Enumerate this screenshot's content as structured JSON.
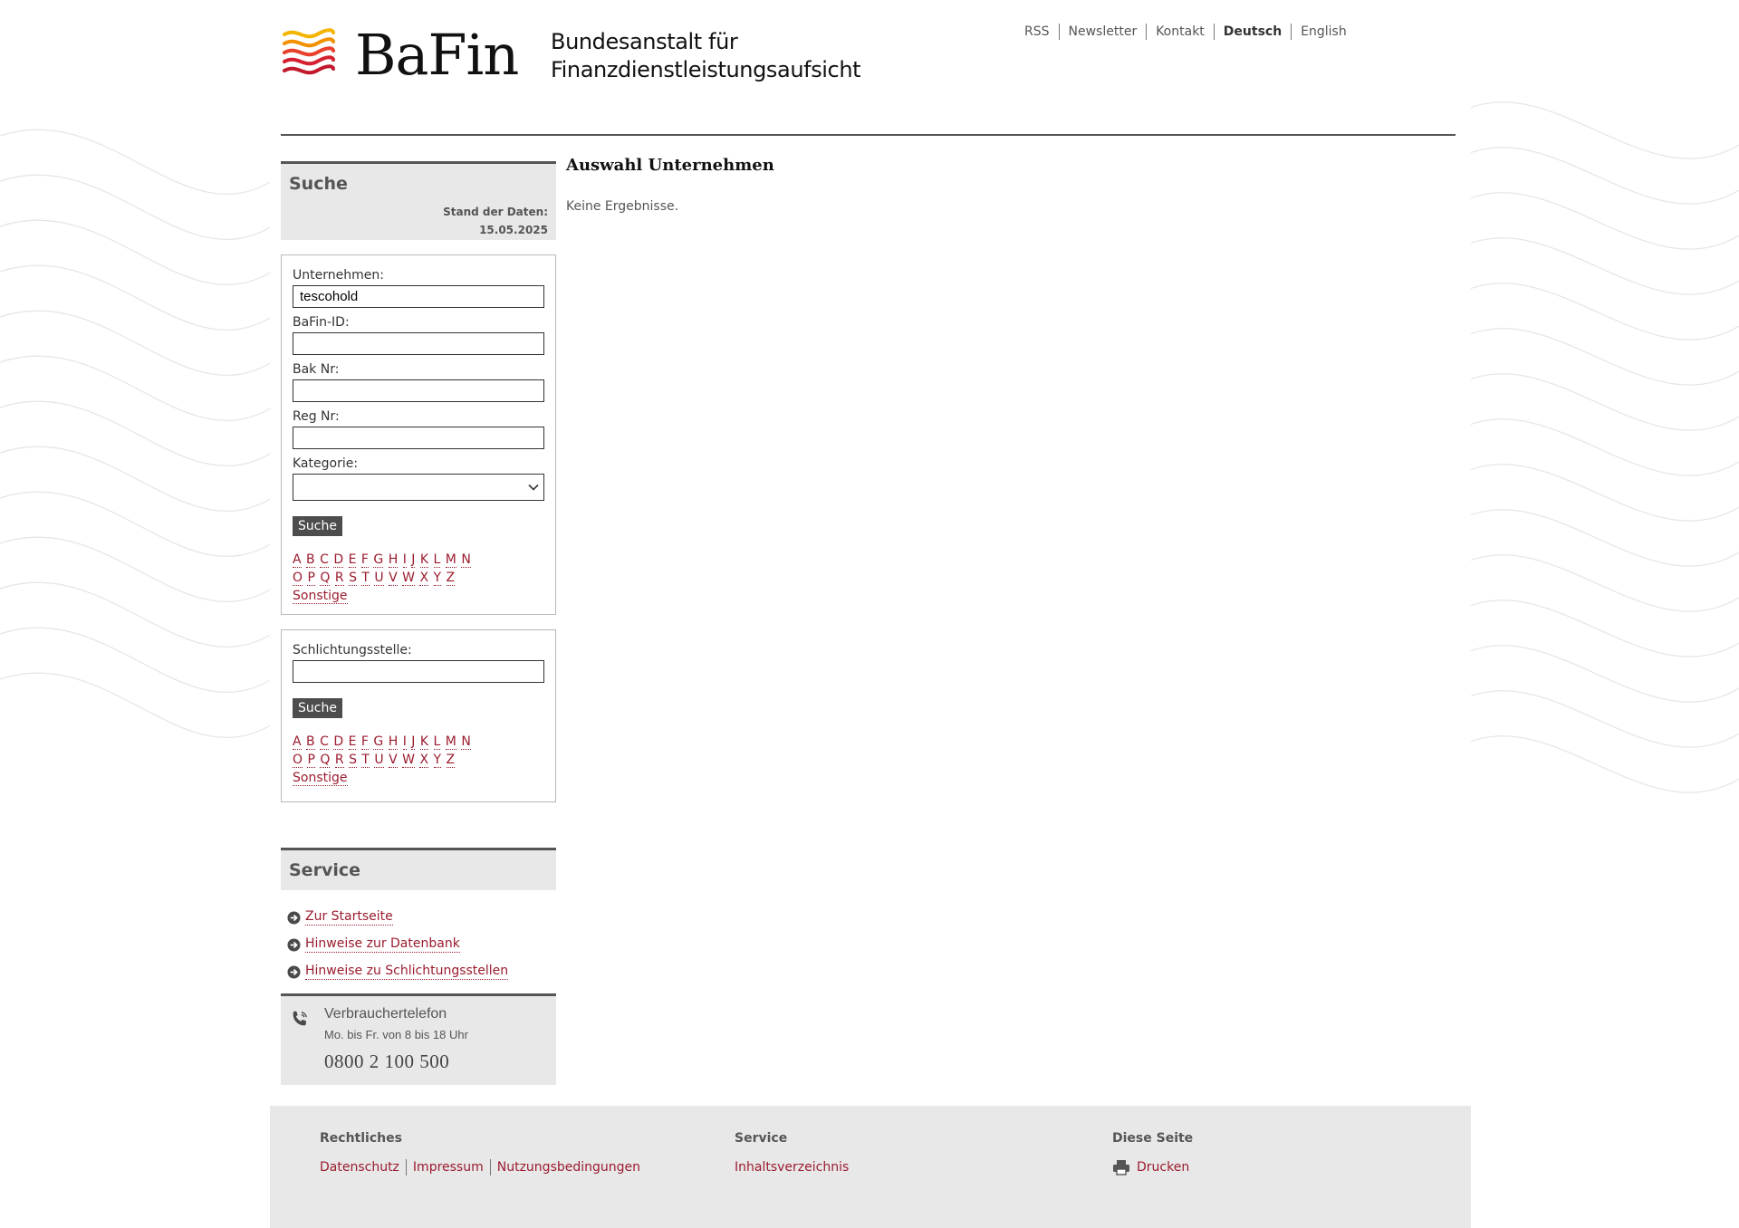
{
  "header": {
    "logo_word": "BaFin",
    "logo_sub_line1": "Bundesanstalt für",
    "logo_sub_line2": "Finanzdienstleistungsaufsicht",
    "nav": [
      {
        "label": "RSS"
      },
      {
        "label": "Newsletter"
      },
      {
        "label": "Kontakt"
      },
      {
        "label": "Deutsch",
        "active": true
      },
      {
        "label": "English"
      }
    ]
  },
  "search": {
    "title": "Suche",
    "stand_label": "Stand der Daten:",
    "stand_date": "15.05.2025",
    "unternehmen_label": "Unternehmen:",
    "unternehmen_value": "tescohold",
    "bafin_id_label": "BaFin-ID:",
    "bafin_id_value": "",
    "bak_nr_label": "Bak Nr:",
    "bak_nr_value": "",
    "reg_nr_label": "Reg Nr:",
    "reg_nr_value": "",
    "kategorie_label": "Kategorie:",
    "kategorie_value": "",
    "button": "Suche",
    "alpha_row1": [
      "A",
      "B",
      "C",
      "D",
      "E",
      "F",
      "G",
      "H",
      "I",
      "J",
      "K",
      "L",
      "M",
      "N"
    ],
    "alpha_row2": [
      "O",
      "P",
      "Q",
      "R",
      "S",
      "T",
      "U",
      "V",
      "W",
      "X",
      "Y",
      "Z"
    ],
    "other": "Sonstige"
  },
  "schlichtung": {
    "label": "Schlichtungsstelle:",
    "value": "",
    "button": "Suche",
    "other": "Sonstige"
  },
  "service": {
    "title": "Service",
    "links": [
      "Zur Startseite",
      "Hinweise zur Datenbank",
      "Hinweise zu Schlichtungsstellen"
    ]
  },
  "phone": {
    "title": "Verbrauchertelefon",
    "hours": "Mo. bis Fr. von 8 bis 18 Uhr",
    "number": "0800 2 100 500"
  },
  "main": {
    "heading": "Auswahl Unternehmen",
    "message": "Keine Ergebnisse."
  },
  "footer": {
    "rechtliches_title": "Rechtliches",
    "rechtliches_links": [
      "Datenschutz",
      "Impressum",
      "Nutzungsbedingungen"
    ],
    "service_title": "Service",
    "service_links": [
      "Inhaltsverzeichnis"
    ],
    "diese_title": "Diese Seite",
    "print_label": "Drucken"
  },
  "colors": {
    "link": "#9b1c2e",
    "panel": "#e8e8e8",
    "button": "#4d4d4d"
  }
}
